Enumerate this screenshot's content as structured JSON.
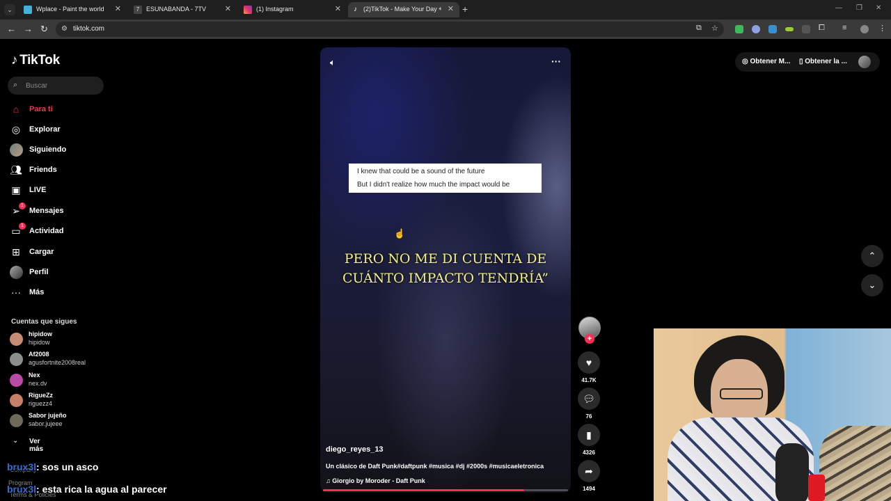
{
  "browser": {
    "tabs": [
      {
        "title": "Wplace - Paint the world",
        "color": "#45b0d9"
      },
      {
        "title": "ESUNABANDA - 7TV",
        "color": "#dddddd"
      },
      {
        "title": "(1) Instagram",
        "color": "#e1306c"
      },
      {
        "title": "(2)TikTok - Make Your Day",
        "color": "#ffffff"
      }
    ],
    "url": "tiktok.com"
  },
  "tiktok": {
    "logo": "TikTok",
    "search_placeholder": "Buscar",
    "nav": [
      {
        "label": "Para ti",
        "icon": "home-icon",
        "active": true
      },
      {
        "label": "Explorar",
        "icon": "compass-icon"
      },
      {
        "label": "Siguiendo",
        "icon": "avatar-icon"
      },
      {
        "label": "Friends",
        "icon": "friends-icon"
      },
      {
        "label": "LIVE",
        "icon": "live-icon"
      },
      {
        "label": "Mensajes",
        "icon": "send-icon",
        "badge": "1"
      },
      {
        "label": "Actividad",
        "icon": "activity-icon",
        "badge": "1"
      },
      {
        "label": "Cargar",
        "icon": "upload-icon"
      },
      {
        "label": "Perfil",
        "icon": "profile-icon"
      },
      {
        "label": "Más",
        "icon": "more-icon"
      }
    ],
    "following_title": "Cuentas que sigues",
    "following": [
      {
        "name": "hipidow",
        "handle": "hipidow",
        "color": "#c88b76"
      },
      {
        "name": "Af2008",
        "handle": "agusfortnite2008real",
        "color": "#8a8f8c"
      },
      {
        "name": "Nex",
        "handle": "nex.dv",
        "color": "#b94aa6"
      },
      {
        "name": "RigueZz",
        "handle": "riguezz4",
        "color": "#c77f6a"
      },
      {
        "name": "Sabor jujeño",
        "handle": "sabor.jujeee",
        "color": "#6e6a5a"
      }
    ],
    "see_more": "Ver más",
    "footer_faded": [
      "Company",
      "Program",
      "Terms & Policies"
    ]
  },
  "chat": [
    {
      "user": "brux3l",
      "message": ": sos un asco"
    },
    {
      "user": "brux3l",
      "message": ": esta rica la agua al parecer"
    }
  ],
  "video": {
    "caption_line1": "I knew that could be a sound of the future",
    "caption_line2": "But I didn't realize how much the impact would be",
    "lyric_line1": "PERO NO ME DI CUENTA DE",
    "lyric_line2": "CUÁNTO IMPACTO TENDRÍA”",
    "username": "diego_reyes_13",
    "description": "Un clásico de Daft Punk#daftpunk #musica #dj #2000s #musicaeletronica",
    "music": "Giorgio by Moroder - Daft Punk",
    "progress": 0.82
  },
  "actions": {
    "likes": "41.7K",
    "comments": "76",
    "saves": "4326",
    "shares": "1494"
  },
  "header_buttons": {
    "get_coins": "Obtener M...",
    "get_app": "Obtener la ..."
  }
}
